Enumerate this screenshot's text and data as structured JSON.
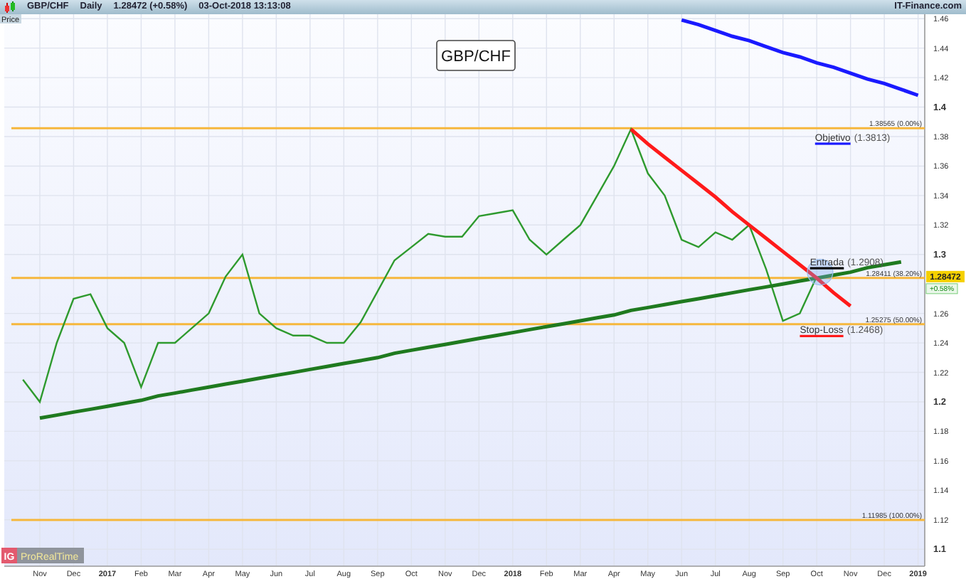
{
  "header": {
    "symbol": "GBP/CHF",
    "period": "Daily",
    "quote": "1.28472 (+0.58%)",
    "timestamp": "03-Oct-2018 13:13:08",
    "source": "IT-Finance.com"
  },
  "chart": {
    "axis_caption": "Price",
    "last_price": "1.28472",
    "change": "+0.58%",
    "chart_data": {
      "type": "line",
      "title": "GBP/CHF",
      "grid": true,
      "ylim": [
        1.0885,
        1.463
      ],
      "categories": [
        null,
        null,
        "Nov",
        null,
        "Dec",
        null,
        "2017",
        null,
        "Feb",
        null,
        "Mar",
        null,
        "Apr",
        null,
        "May",
        null,
        "Jun",
        null,
        "Jul",
        null,
        "Aug",
        null,
        "Sep",
        null,
        "Oct",
        null,
        "Nov",
        null,
        "Dec",
        null,
        "2018",
        null,
        "Feb",
        null,
        "Mar",
        null,
        "Apr",
        null,
        "May",
        null,
        "Jun",
        null,
        "Jul",
        null,
        "Aug",
        null,
        "Sep",
        null,
        "Oct",
        null,
        "Nov",
        null,
        "Dec",
        null,
        "2019"
      ],
      "series": [
        {
          "color": "#2e9a2e",
          "values": [
            null,
            1.215,
            1.2,
            1.24,
            1.27,
            1.273,
            1.25,
            1.24,
            1.21,
            1.24,
            1.24,
            1.25,
            1.26,
            1.285,
            1.3,
            1.26,
            1.25,
            1.245,
            1.245,
            1.24,
            1.24,
            1.254,
            1.275,
            1.296,
            1.305,
            1.314,
            1.312,
            1.312,
            1.326,
            1.328,
            1.33,
            1.31,
            1.3,
            1.31,
            1.32,
            1.34,
            1.36,
            1.385,
            1.355,
            1.34,
            1.31,
            1.305,
            1.315,
            1.31,
            1.32,
            1.29,
            1.255,
            1.26,
            1.285,
            null,
            null,
            null,
            null,
            null,
            null
          ]
        },
        {
          "color": "#1f7a1f",
          "values": [
            null,
            null,
            1.189,
            1.191,
            1.193,
            1.195,
            1.197,
            1.199,
            1.201,
            1.204,
            1.206,
            1.208,
            1.21,
            1.212,
            1.214,
            1.216,
            1.218,
            1.22,
            1.222,
            1.224,
            1.226,
            1.228,
            1.23,
            1.233,
            1.235,
            1.237,
            1.239,
            1.241,
            1.243,
            1.245,
            1.247,
            1.249,
            1.251,
            1.253,
            1.255,
            1.257,
            1.259,
            1.262,
            1.264,
            1.266,
            1.268,
            1.27,
            1.272,
            1.274,
            1.276,
            1.278,
            1.28,
            1.282,
            1.284,
            1.286,
            1.288,
            1.291,
            1.293,
            1.295,
            null
          ]
        },
        {
          "color": "#ff1a1a",
          "values": [
            null,
            null,
            null,
            null,
            null,
            null,
            null,
            null,
            null,
            null,
            null,
            null,
            null,
            null,
            null,
            null,
            null,
            null,
            null,
            null,
            null,
            null,
            null,
            null,
            null,
            null,
            null,
            null,
            null,
            null,
            null,
            null,
            null,
            null,
            null,
            null,
            null,
            1.385,
            1.375,
            1.366,
            1.357,
            1.348,
            1.339,
            1.329,
            1.32,
            1.311,
            1.302,
            1.293,
            1.284,
            1.274,
            1.265,
            null,
            null,
            null,
            null
          ]
        },
        {
          "color": "#1a1aff",
          "values": [
            null,
            null,
            null,
            null,
            null,
            null,
            null,
            null,
            null,
            null,
            null,
            null,
            null,
            null,
            null,
            null,
            null,
            null,
            null,
            null,
            null,
            null,
            null,
            null,
            null,
            null,
            null,
            null,
            null,
            null,
            null,
            null,
            null,
            null,
            null,
            null,
            null,
            null,
            null,
            null,
            1.459,
            1.456,
            1.452,
            1.448,
            1.445,
            1.441,
            1.437,
            1.434,
            1.43,
            1.427,
            1.423,
            1.419,
            1.416,
            1.412,
            1.408
          ]
        }
      ],
      "yticks": [
        {
          "value": 1.46,
          "label": "1.46"
        },
        {
          "value": 1.44,
          "label": "1.44"
        },
        {
          "value": 1.42,
          "label": "1.42"
        },
        {
          "value": 1.4,
          "label": "1.4"
        },
        {
          "value": 1.38,
          "label": "1.38"
        },
        {
          "value": 1.36,
          "label": "1.36"
        },
        {
          "value": 1.34,
          "label": "1.34"
        },
        {
          "value": 1.32,
          "label": "1.32"
        },
        {
          "value": 1.3,
          "label": "1.3"
        },
        {
          "value": 1.26,
          "label": "1.26"
        },
        {
          "value": 1.24,
          "label": "1.24"
        },
        {
          "value": 1.22,
          "label": "1.22"
        },
        {
          "value": 1.2,
          "label": "1.2"
        },
        {
          "value": 1.18,
          "label": "1.18"
        },
        {
          "value": 1.16,
          "label": "1.16"
        },
        {
          "value": 1.14,
          "label": "1.14"
        },
        {
          "value": 1.12,
          "label": "1.12"
        },
        {
          "value": 1.1,
          "label": "1.1"
        }
      ],
      "ref_lines": [
        {
          "axis": "y",
          "value": 1.38565,
          "label": "1.38565 (0.00%)"
        },
        {
          "axis": "y",
          "value": 1.28411,
          "label": "1.28411 (38.20%)"
        },
        {
          "axis": "y",
          "value": 1.25275,
          "label": "1.25275 (50.00%)"
        },
        {
          "axis": "y",
          "value": 1.11985,
          "label": "1.11985 (100.00%)"
        }
      ]
    },
    "notes": [
      {
        "label": "Objetivo",
        "value_text": "(1.3813)",
        "color": "#1a1aff"
      },
      {
        "label": "Entrada",
        "value_text": "(1.2908)",
        "color": "#000000"
      },
      {
        "label": "Stop-Loss",
        "value_text": "(1.2468)",
        "color": "#ff1a1a"
      }
    ]
  },
  "branding": {
    "logo": "IG",
    "name": "ProRealTime"
  }
}
